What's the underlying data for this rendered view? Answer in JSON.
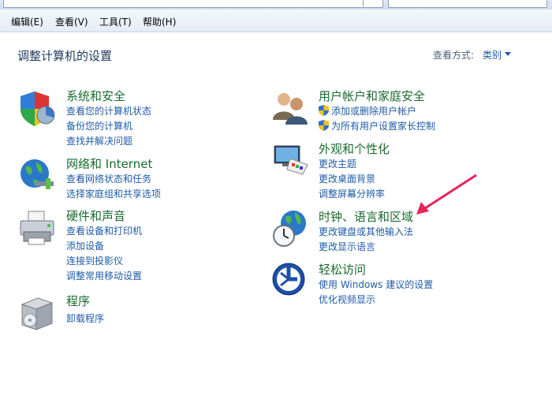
{
  "menu": {
    "edit": "编辑(E)",
    "view": "查看(V)",
    "tools": "工具(T)",
    "help": "帮助(H)"
  },
  "page_title": "调整计算机的设置",
  "view_by": {
    "label": "查看方式:",
    "value": "类别"
  },
  "categories": {
    "system": {
      "title": "系统和安全",
      "links": [
        "查看您的计算机状态",
        "备份您的计算机",
        "查找并解决问题"
      ]
    },
    "network": {
      "title": "网络和 Internet",
      "links": [
        "查看网络状态和任务",
        "选择家庭组和共享选项"
      ]
    },
    "hardware": {
      "title": "硬件和声音",
      "links": [
        "查看设备和打印机",
        "添加设备",
        "连接到投影仪",
        "调整常用移动设置"
      ]
    },
    "programs": {
      "title": "程序",
      "links": [
        "卸载程序"
      ]
    },
    "users": {
      "title": "用户帐户和家庭安全",
      "links": [
        "添加或删除用户帐户",
        "为所有用户设置家长控制"
      ]
    },
    "appearance": {
      "title": "外观和个性化",
      "links": [
        "更改主题",
        "更改桌面背景",
        "调整屏幕分辨率"
      ]
    },
    "clock": {
      "title": "时钟、语言和区域",
      "links": [
        "更改键盘或其他输入法",
        "更改显示语言"
      ]
    },
    "ease": {
      "title": "轻松访问",
      "links": [
        "使用 Windows 建议的设置",
        "优化视频显示"
      ]
    }
  },
  "colors": {
    "title_green": "#1a6a2e",
    "link_blue": "#1e5ba8",
    "annotation_arrow": "#e8245a"
  }
}
